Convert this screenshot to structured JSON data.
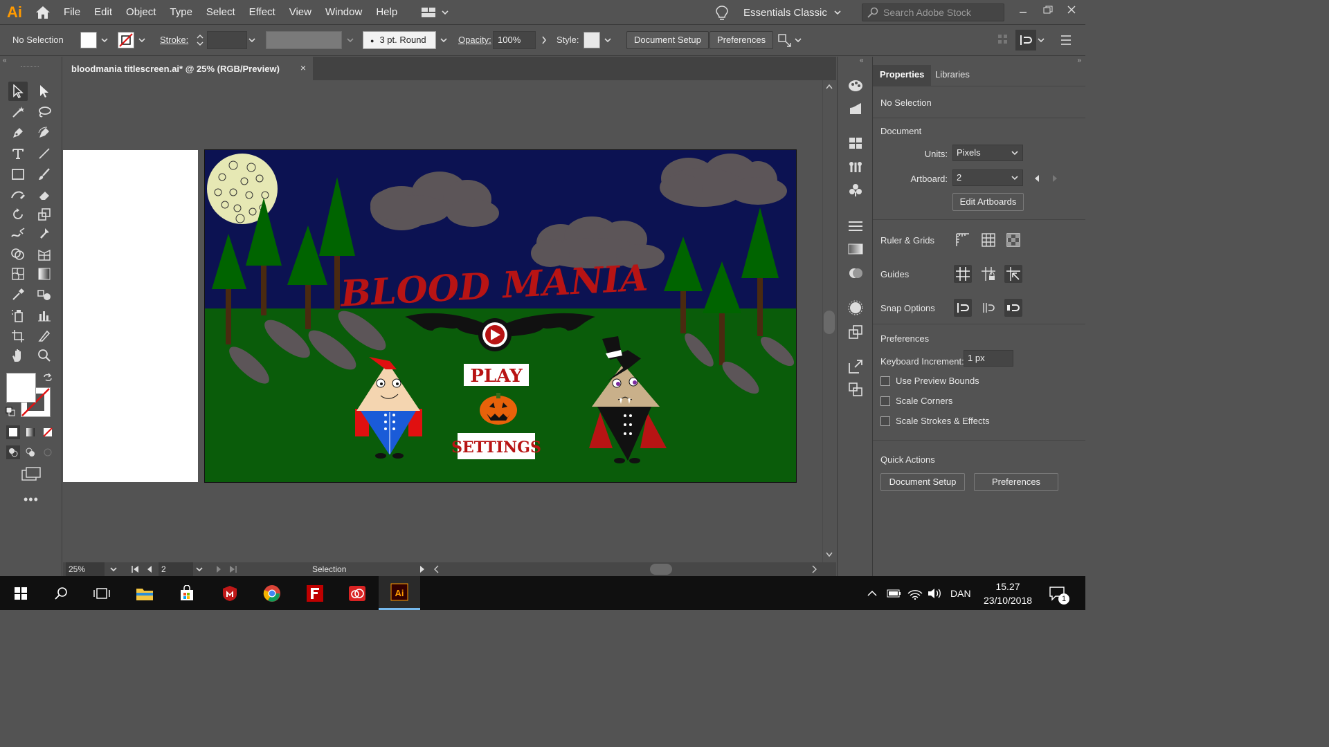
{
  "app": {
    "logo": "Ai",
    "menus": [
      "File",
      "Edit",
      "Object",
      "Type",
      "Select",
      "Effect",
      "View",
      "Window",
      "Help"
    ],
    "workspace": "Essentials Classic",
    "search_placeholder": "Search Adobe Stock"
  },
  "controlbar": {
    "selection": "No Selection",
    "stroke_label": "Stroke:",
    "brush": "3 pt. Round",
    "opacity_label": "Opacity:",
    "opacity": "100%",
    "style_label": "Style:",
    "document_setup": "Document Setup",
    "preferences": "Preferences"
  },
  "document": {
    "tab_title": "bloodmania titlescreen.ai* @ 25% (RGB/Preview)",
    "close": "×"
  },
  "artwork": {
    "title": "BLOOD MANIA",
    "play": "PLAY",
    "settings": "SETTINGS",
    "colors": {
      "sky": "#0c1252",
      "grass": "#0a5c0a",
      "tree": "#006400",
      "trunk": "#4a2a10",
      "cloud": "#5c5558",
      "moon": "#e6e8b4",
      "title": "#b81414",
      "pumpkin": "#e8620a"
    }
  },
  "status": {
    "zoom": "25%",
    "artboard": "2",
    "tool": "Selection"
  },
  "properties": {
    "tab_properties": "Properties",
    "tab_libraries": "Libraries",
    "no_selection": "No Selection",
    "document_heading": "Document",
    "units_label": "Units:",
    "units_value": "Pixels",
    "artboard_label": "Artboard:",
    "artboard_value": "2",
    "edit_artboards": "Edit Artboards",
    "ruler_grids": "Ruler & Grids",
    "guides": "Guides",
    "snap_options": "Snap Options",
    "preferences_heading": "Preferences",
    "keyboard_increment_label": "Keyboard Increment:",
    "keyboard_increment_value": "1 px",
    "use_preview_bounds": "Use Preview Bounds",
    "scale_corners": "Scale Corners",
    "scale_strokes": "Scale Strokes & Effects",
    "quick_actions": "Quick Actions",
    "qa_document_setup": "Document Setup",
    "qa_preferences": "Preferences"
  },
  "taskbar": {
    "language": "DAN",
    "time": "15.27",
    "date": "23/10/2018",
    "notifications": "1",
    "apps": [
      "windows-start-icon",
      "search-icon",
      "task-view-icon",
      "file-explorer-icon",
      "store-icon",
      "mcafee-icon",
      "chrome-icon",
      "filezilla-icon",
      "creative-cloud-icon",
      "illustrator-icon"
    ]
  }
}
